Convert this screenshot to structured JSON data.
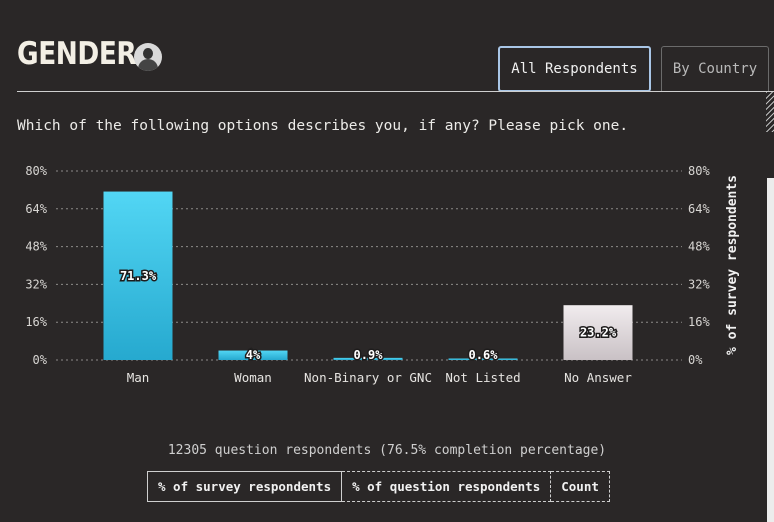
{
  "header": {
    "title": "GENDER"
  },
  "tabs": [
    {
      "label": "All Respondents",
      "active": true
    },
    {
      "label": "By Country",
      "active": false
    }
  ],
  "question": "Which of the following options describes you, if any? Please pick one.",
  "chart_data": {
    "type": "bar",
    "categories": [
      "Man",
      "Woman",
      "Non-Binary or GNC",
      "Not Listed",
      "No Answer"
    ],
    "values": [
      71.3,
      4,
      0.9,
      0.6,
      23.2
    ],
    "value_labels": [
      "71.3%",
      "4%",
      "0.9%",
      "0.6%",
      "23.2%"
    ],
    "ylim": [
      0,
      80
    ],
    "yticks": [
      0,
      16,
      32,
      48,
      64,
      80
    ],
    "ytick_labels": [
      "0%",
      "16%",
      "32%",
      "48%",
      "64%",
      "80%"
    ],
    "ylabel_right": "% of survey respondents",
    "colors": [
      "#2fb4d8",
      "#2fb4d8",
      "#2fb4d8",
      "#2fb4d8",
      "#ddd6d8"
    ],
    "grid": true
  },
  "summary": "12305 question respondents (76.5% completion percentage)",
  "toggles": [
    {
      "label": "% of survey respondents",
      "active": true
    },
    {
      "label": "% of question respondents",
      "active": false
    },
    {
      "label": "Count",
      "active": false
    }
  ]
}
